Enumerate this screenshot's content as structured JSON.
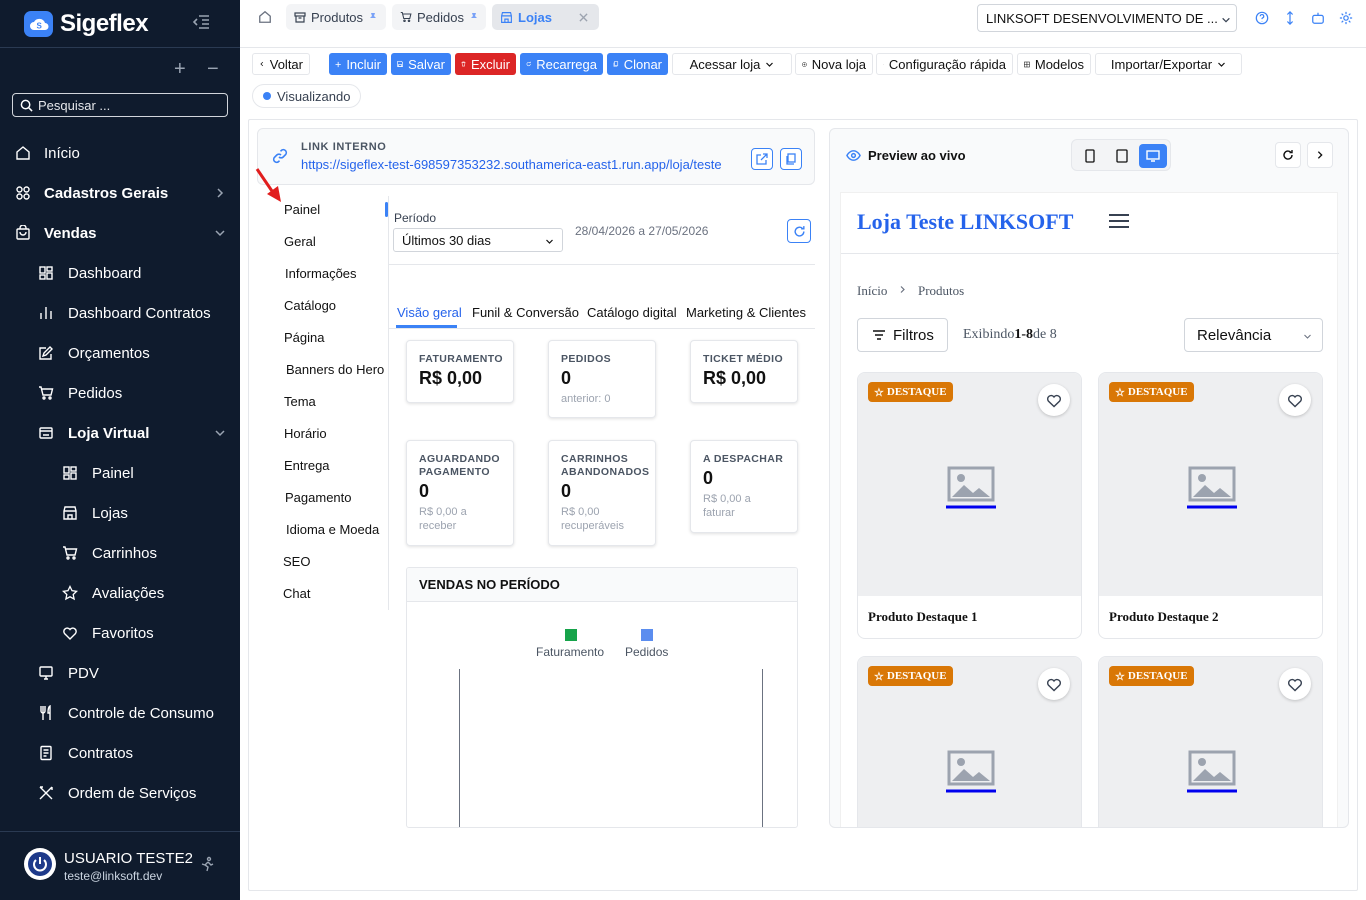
{
  "app": {
    "name": "Sigeflex"
  },
  "sidebar": {
    "search_placeholder": "Pesquisar ...",
    "plus": "+",
    "minus": "−",
    "items": {
      "inicio": "Início",
      "cadastros": "Cadastros Gerais",
      "vendas": "Vendas",
      "dashboard": "Dashboard",
      "dashboard_contratos": "Dashboard Contratos",
      "orcamentos": "Orçamentos",
      "pedidos": "Pedidos",
      "loja_virtual": "Loja Virtual",
      "painel": "Painel",
      "lojas": "Lojas",
      "carrinhos": "Carrinhos",
      "avaliacoes": "Avaliações",
      "favoritos": "Favoritos",
      "pdv": "PDV",
      "controle_consumo": "Controle de Consumo",
      "contratos": "Contratos",
      "ordem_servicos": "Ordem de Serviços"
    },
    "user": {
      "name": "USUARIO TESTE2",
      "email": "teste@linksoft.dev"
    }
  },
  "topbar": {
    "tabs": [
      {
        "label": "Produtos"
      },
      {
        "label": "Pedidos"
      },
      {
        "label": "Lojas"
      }
    ],
    "company": "LINKSOFT DESENVOLVIMENTO DE ..."
  },
  "toolbar": {
    "voltar": "Voltar",
    "incluir": "Incluir",
    "salvar": "Salvar",
    "excluir": "Excluir",
    "recarrega": "Recarrega",
    "clonar": "Clonar",
    "acessar_loja": "Acessar loja",
    "nova_loja": "Nova loja",
    "config_rapida": "Configuração rápida",
    "modelos": "Modelos",
    "importar": "Importar/Exportar",
    "status": "Visualizando"
  },
  "link": {
    "label": "LINK INTERNO",
    "url": "https://sigeflex-test-698597353232.southamerica-east1.run.app/loja/teste"
  },
  "sectionnav": {
    "painel": "Painel",
    "geral": "Geral",
    "informacoes": "Informações",
    "catalogo": "Catálogo",
    "pagina": "Página",
    "banners": "Banners do Hero",
    "tema": "Tema",
    "horario": "Horário",
    "entrega": "Entrega",
    "pagamento": "Pagamento",
    "idioma": "Idioma e Moeda",
    "seo": "SEO",
    "chat": "Chat"
  },
  "periodo": {
    "label": "Período",
    "selected": "Últimos 30 dias",
    "range": "28/04/2026 a 27/05/2026"
  },
  "content_tabs": [
    "Visão geral",
    "Funil & Conversão",
    "Catálogo digital",
    "Marketing & Clientes"
  ],
  "cards": [
    {
      "title": "FATURAMENTO",
      "value": "R$ 0,00",
      "sub": ""
    },
    {
      "title": "PEDIDOS",
      "value": "0",
      "sub": "anterior: 0"
    },
    {
      "title": "TICKET MÉDIO",
      "value": "R$ 0,00",
      "sub": ""
    },
    {
      "title": "AGUARDANDO PAGAMENTO",
      "value": "0",
      "sub": "R$ 0,00 a receber"
    },
    {
      "title": "CARRINHOS ABANDONADOS",
      "value": "0",
      "sub": "R$ 0,00 recuperáveis"
    },
    {
      "title": "A DESPACHAR",
      "value": "0",
      "sub": "R$ 0,00 a faturar"
    }
  ],
  "sales_chart": {
    "title": "VENDAS NO PERÍODO",
    "legend": [
      {
        "name": "Faturamento",
        "color": "#16a34a"
      },
      {
        "name": "Pedidos",
        "color": "#5b8def"
      }
    ]
  },
  "preview": {
    "title": "Preview ao vivo",
    "store_name": "Loja Teste LINKSOFT",
    "breadcrumb": {
      "home": "Início",
      "current": "Produtos"
    },
    "filters": "Filtros",
    "showing_prefix": "Exibindo",
    "showing_range": "1-8",
    "showing_suffix": "de 8",
    "sort": "Relevância",
    "badge": "DESTAQUE",
    "products": [
      {
        "name": "Produto Destaque 1"
      },
      {
        "name": "Produto Destaque 2"
      },
      {
        "name": ""
      },
      {
        "name": ""
      }
    ]
  },
  "colors": {
    "accent": "#3b82f6",
    "sidebar_bg": "#0f1b2d",
    "danger": "#dc2626",
    "badge": "#d97706"
  }
}
